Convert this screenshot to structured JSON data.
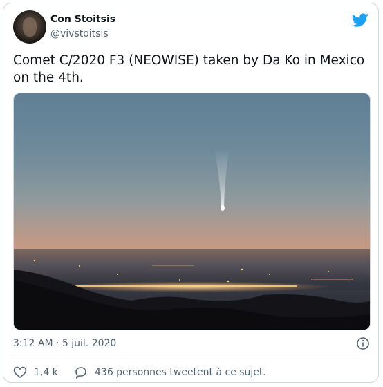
{
  "tweet": {
    "author_name": "Con Stoitsis",
    "author_handle": "@vivstoitsis",
    "text": "Comet C/2020 F3 (NEOWISE) taken by Da Ko in Mexico on the 4th.",
    "timestamp": "3:12 AM · 5 juil. 2020",
    "like_count": "1,4 k",
    "discussion_text": "436 personnes tweetent à ce sujet."
  },
  "icons": {
    "brand": "twitter-bird-icon",
    "info": "info-icon",
    "like": "heart-icon",
    "reply": "speech-bubble-icon"
  },
  "colors": {
    "brand": "#1da1f2",
    "secondary_text": "#536471",
    "primary_text": "#0f1419",
    "border": "#cfd9de"
  }
}
